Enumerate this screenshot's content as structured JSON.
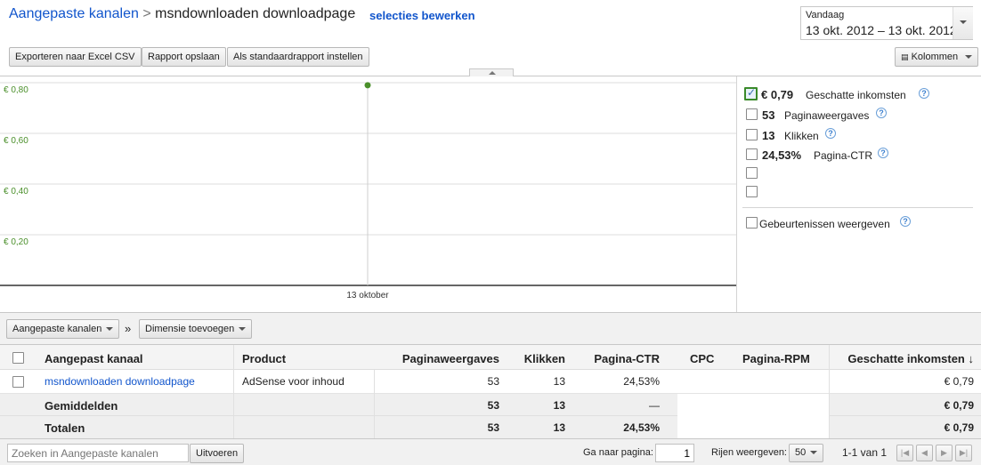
{
  "header": {
    "breadcrumb_root": "Aangepaste kanalen",
    "breadcrumb_sep": ">",
    "title": "msndownloaden downloadpage",
    "edit_link": "selecties bewerken"
  },
  "date_range": {
    "label": "Vandaag",
    "value": "13 okt. 2012 – 13 okt. 2012"
  },
  "toolbar": {
    "export": "Exporteren naar Excel CSV",
    "save": "Rapport opslaan",
    "default": "Als standaardrapport instellen",
    "columns": "Kolommen"
  },
  "chart_data": {
    "type": "line",
    "x": [
      "13 oktober"
    ],
    "series": [
      {
        "values": [
          0.79
        ]
      }
    ],
    "ylim": [
      0,
      0.8
    ],
    "yticks": [
      "€ 0,80",
      "€ 0,60",
      "€ 0,40",
      "€ 0,20"
    ],
    "xlabel": "",
    "ylabel": "",
    "series_color": "#4a8f2a"
  },
  "metrics": [
    {
      "value": "€ 0,79",
      "label": "Geschatte inkomsten",
      "checked": true
    },
    {
      "value": "53",
      "label": "Paginaweergaves",
      "checked": false
    },
    {
      "value": "13",
      "label": "Klikken",
      "checked": false
    },
    {
      "value": "24,53%",
      "label": "Pagina-CTR",
      "checked": false
    }
  ],
  "events_label": "Gebeurtenissen weergeven",
  "dimension_bar": {
    "dimension": "Aangepaste kanalen",
    "sep": "»",
    "add": "Dimensie toevoegen"
  },
  "table": {
    "headers": [
      "Aangepast kanaal",
      "Product",
      "Paginaweergaves",
      "Klikken",
      "Pagina-CTR",
      "CPC",
      "Pagina-RPM",
      "Geschatte inkomsten ↓"
    ],
    "row": [
      "msndownloaden downloadpage",
      "AdSense voor inhoud",
      "53",
      "13",
      "24,53%",
      "",
      "",
      "€ 0,79"
    ],
    "avg": [
      "Gemiddelden",
      "",
      "53",
      "13",
      "—",
      "",
      "",
      "€ 0,79"
    ],
    "total": [
      "Totalen",
      "",
      "53",
      "13",
      "24,53%",
      "",
      "",
      "€ 0,79"
    ]
  },
  "footer": {
    "search_placeholder": "Zoeken in Aangepaste kanalen",
    "run": "Uitvoeren",
    "goto_label": "Ga naar pagina:",
    "goto_value": "1",
    "rows_label": "Rijen weergeven:",
    "rows_value": "50",
    "range": "1-1 van 1"
  },
  "colors": {
    "link": "#1155cc",
    "accent_green": "#4a8f2a"
  }
}
